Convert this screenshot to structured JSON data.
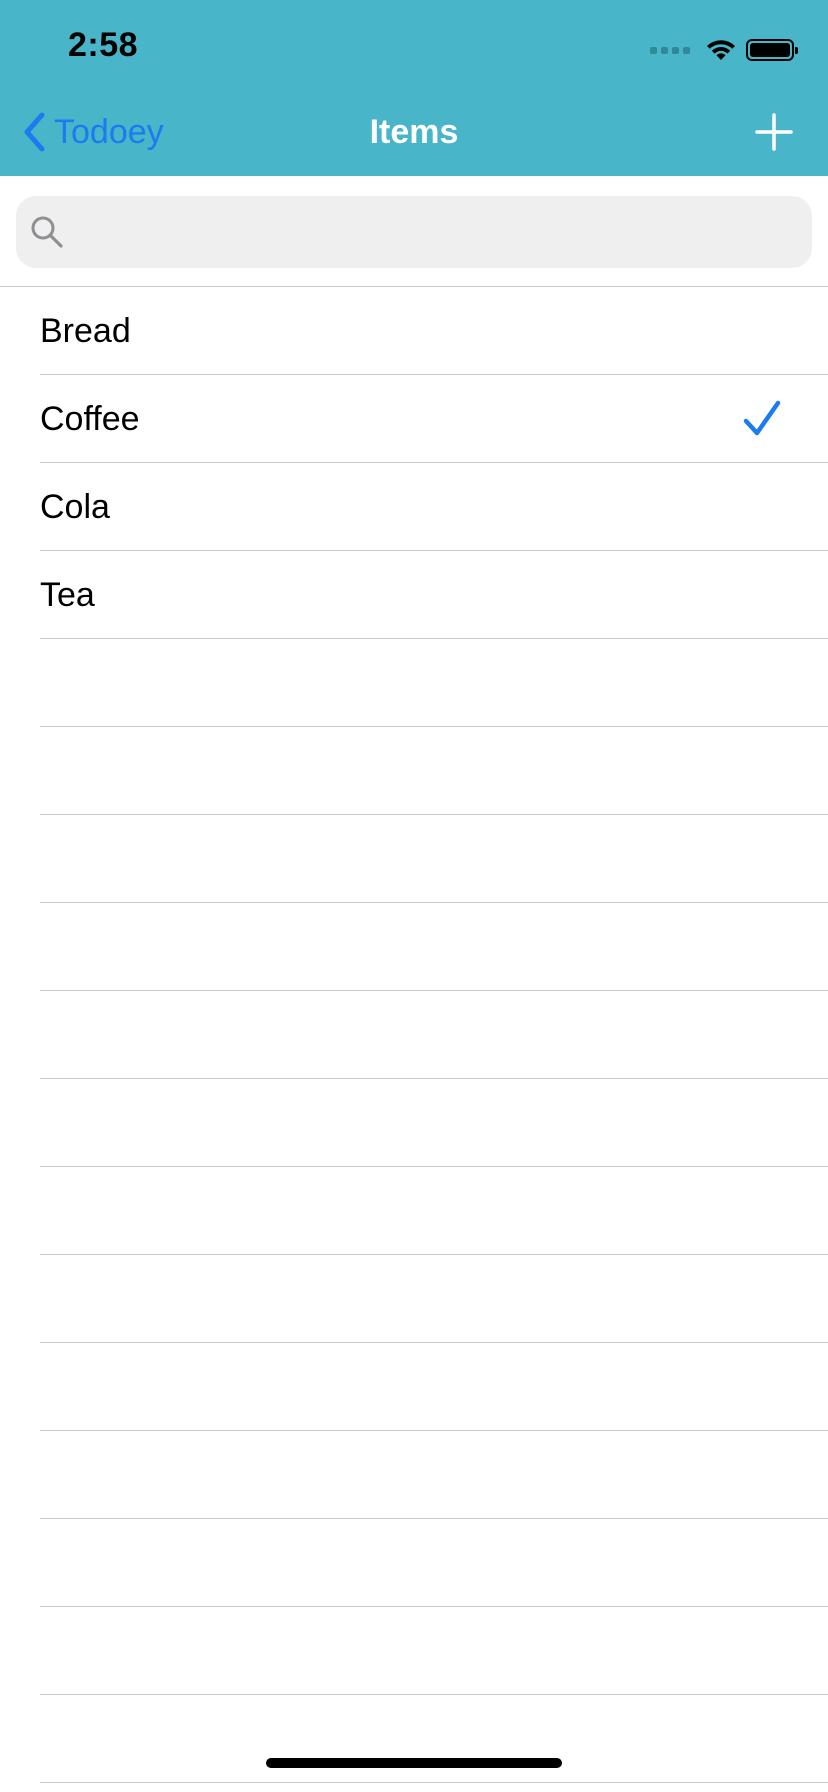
{
  "status_bar": {
    "time": "2:58"
  },
  "nav": {
    "back_label": "Todoey",
    "title": "Items",
    "add_icon": "plus-icon",
    "colors": {
      "bar": "#48b5c9",
      "back": "#1a7cf0",
      "title": "#ffffff"
    }
  },
  "search": {
    "placeholder": "",
    "value": "",
    "icon": "search-icon"
  },
  "items": [
    {
      "label": "Bread",
      "checked": false
    },
    {
      "label": "Coffee",
      "checked": true
    },
    {
      "label": "Cola",
      "checked": false
    },
    {
      "label": "Tea",
      "checked": false
    },
    {
      "label": "",
      "checked": false
    },
    {
      "label": "",
      "checked": false
    },
    {
      "label": "",
      "checked": false
    },
    {
      "label": "",
      "checked": false
    },
    {
      "label": "",
      "checked": false
    },
    {
      "label": "",
      "checked": false
    },
    {
      "label": "",
      "checked": false
    },
    {
      "label": "",
      "checked": false
    },
    {
      "label": "",
      "checked": false
    },
    {
      "label": "",
      "checked": false
    },
    {
      "label": "",
      "checked": false
    },
    {
      "label": "",
      "checked": false
    },
    {
      "label": "",
      "checked": false
    }
  ],
  "accent_color": "#1a7cf0"
}
